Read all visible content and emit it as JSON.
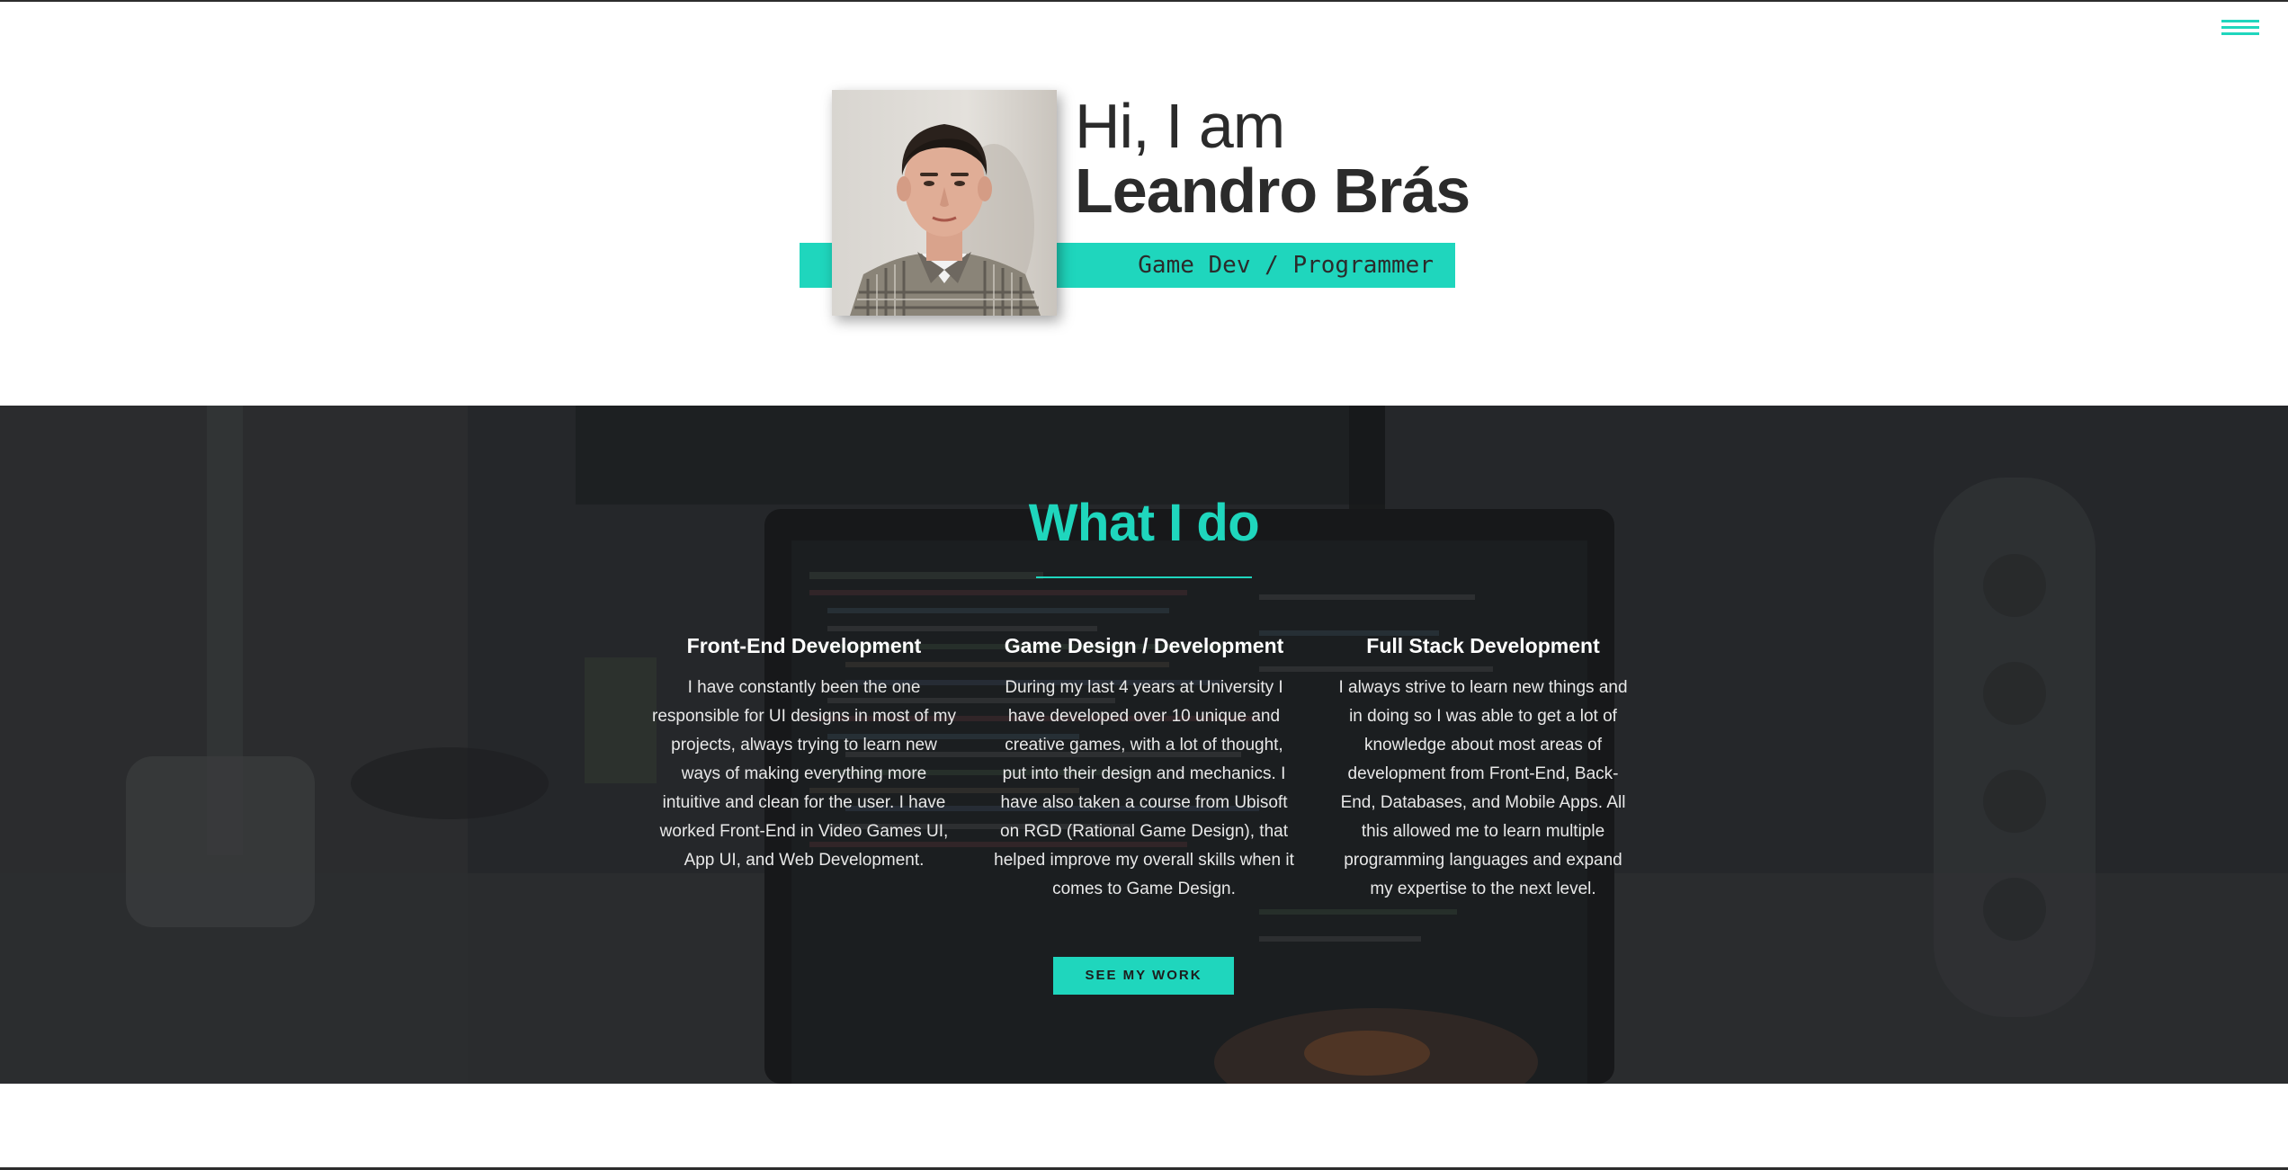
{
  "hero": {
    "greeting": "Hi, I am",
    "name": "Leandro Brás",
    "role": "Game Dev / Programmer"
  },
  "services": {
    "title": "What I do",
    "items": [
      {
        "title": "Front-End Development",
        "text": "I have constantly been the one responsible for UI designs in most of my projects, always trying to learn new ways of making everything more intuitive and clean for the user. I have worked Front-End in Video Games UI, App UI, and Web Development."
      },
      {
        "title": "Game Design / Development",
        "text": "During my last 4 years at University I have developed over 10 unique and creative games, with a lot of thought, put into their design and mechanics. I have also taken a course from Ubisoft on RGD (Rational Game Design), that helped improve my overall skills when it comes to Game Design."
      },
      {
        "title": "Full Stack Development",
        "text": "I always strive to learn new things and in doing so I was able to get a lot of knowledge about most areas of development from Front-End, Back-End, Databases, and Mobile Apps. All this allowed me to learn multiple programming languages and expand my expertise to the next level."
      }
    ],
    "cta_label": "SEE MY WORK"
  },
  "colors": {
    "accent": "#1fd6bd",
    "text_dark": "#2b2b2b",
    "section_bg": "#222426"
  },
  "icons": {
    "menu": "hamburger-menu-icon"
  }
}
